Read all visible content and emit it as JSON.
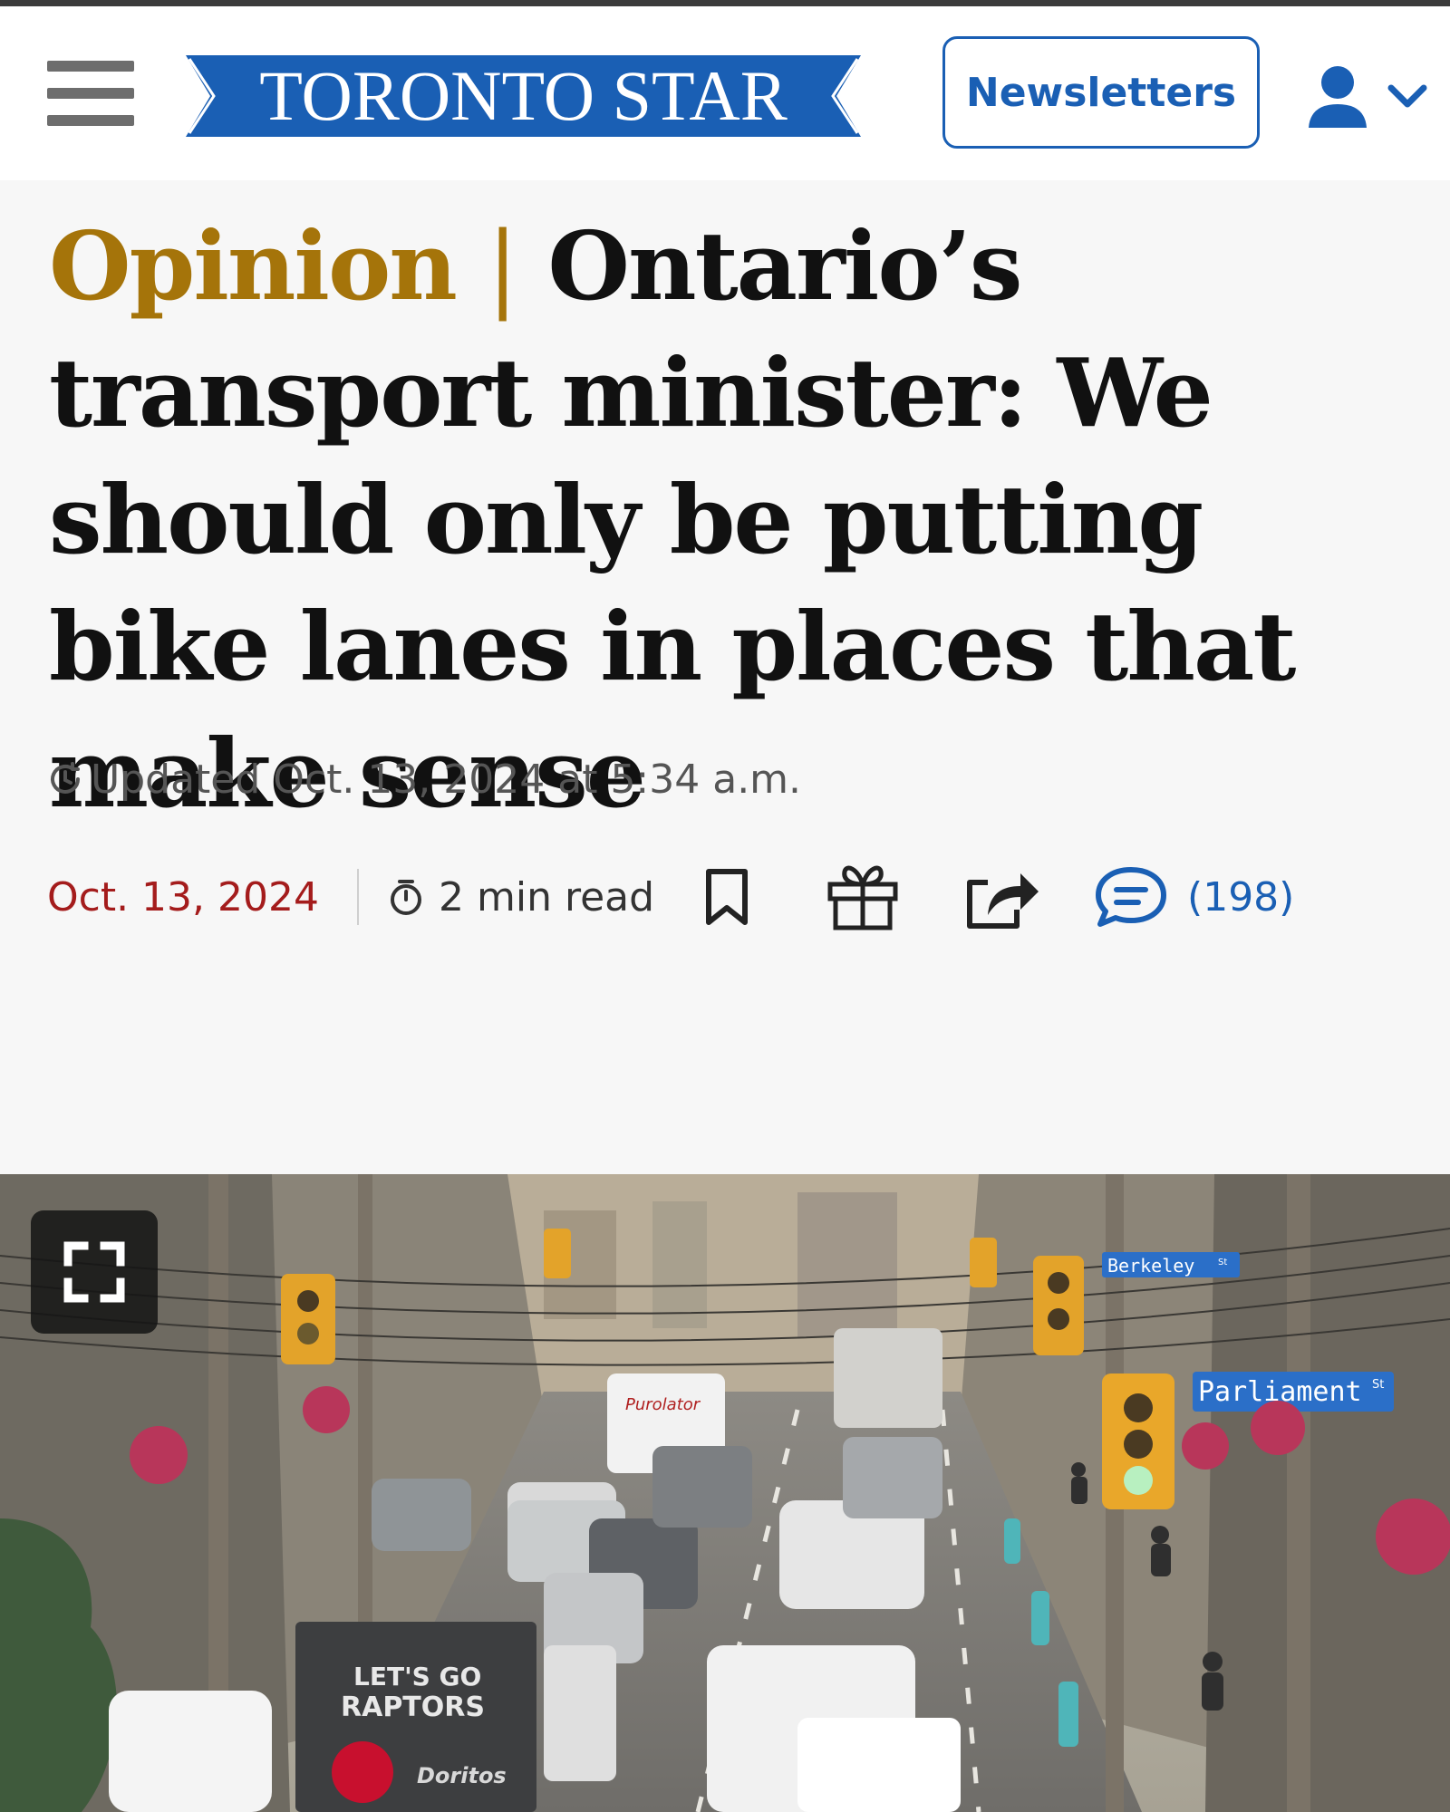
{
  "header": {
    "logo_text": "TORONTO STAR",
    "newsletters_label": "Newsletters",
    "brand_color": "#1a5fb4"
  },
  "article": {
    "section": "Opinion",
    "separator": "|",
    "title": "Ontario’s transport minister: We should only be putting bike lanes in places that make sense",
    "updated": "Updated Oct. 13, 2024 at 5:34 a.m.",
    "date": "Oct. 13, 2024",
    "read_time": "2 min read",
    "comment_count": "(198)"
  },
  "hero": {
    "truck_text_1": "LET'S GO",
    "truck_text_2": "RAPTORS",
    "truck_brand": "Doritos",
    "van_brand": "Purolator",
    "sign_parliament": "Parliament",
    "sign_parliament_suffix": "St",
    "sign_berkeley": "Berkeley",
    "sign_berkeley_suffix": "St"
  },
  "colors": {
    "section_gold": "#a5740a",
    "date_red": "#a41c1c",
    "comment_blue": "#1a5fb4"
  },
  "icons": [
    "menu-icon",
    "account-icon",
    "chevron-down-icon",
    "clock-icon",
    "timer-icon",
    "bookmark-icon",
    "gift-icon",
    "share-icon",
    "comment-icon",
    "expand-icon"
  ]
}
